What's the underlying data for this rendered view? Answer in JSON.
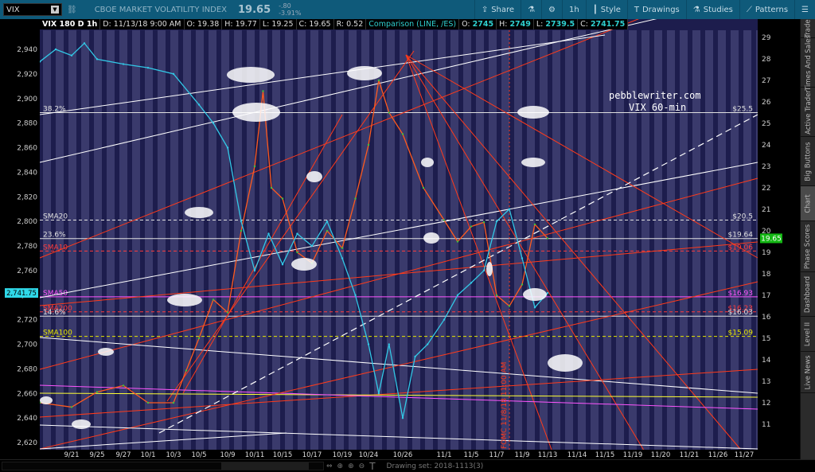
{
  "toolbar": {
    "symbol": "VIX",
    "name": "CBOE MARKET VOLATILITY INDEX",
    "price": "19.65",
    "change": "-.80",
    "change_pct": "-3.91%",
    "buttons": [
      {
        "label": "Share",
        "icon": "share-icon"
      },
      {
        "label": "",
        "icon": "flask-icon"
      },
      {
        "label": "",
        "icon": "gear-icon"
      },
      {
        "label": "1h",
        "icon": ""
      },
      {
        "label": "Style",
        "icon": "candle-icon"
      },
      {
        "label": "Drawings",
        "icon": "text-tool-icon"
      },
      {
        "label": "Studies",
        "icon": "flask-icon"
      },
      {
        "label": "Patterns",
        "icon": "pattern-icon"
      },
      {
        "label": "",
        "icon": "menu-icon"
      }
    ]
  },
  "infobar": {
    "title": "VIX 180 D 1h",
    "date": "D: 11/13/18 9:00 AM",
    "open": "O: 19.38",
    "high": "H: 19.77",
    "low": "L: 19.25",
    "close": "C: 19.65",
    "range": "R: 0.52",
    "comparison": "Comparison (LINE, /ES)",
    "cmp_open": "2745",
    "cmp_high": "2749",
    "cmp_low": "2739.5",
    "cmp_close": "2741.75"
  },
  "right_tabs": [
    "Trade",
    "Times And Sales",
    "Active Trader",
    "Big Buttons",
    "Chart",
    "Phase Scores",
    "Dashboard",
    "Level II",
    "Live News"
  ],
  "bottom": {
    "drawing_set": "Drawing set: 2018-1113(3)"
  },
  "annotations": {
    "site": "pebblewriter.com",
    "subtitle": "VIX 60-min",
    "fomc": "FOMC 11/8/18 11:00 AM"
  },
  "colors": {
    "bg": "#1d1d4d",
    "stripe": "#3a3a6c",
    "vix_up": "#3fbf3f",
    "vix_down": "#ff5a1e",
    "es": "#32c8e6",
    "accent": "#0f5a7a"
  },
  "chart_data": {
    "type": "line",
    "title": "VIX 180 D 1h with /ES comparison",
    "x_ticks": [
      "9/21",
      "9/25",
      "9/27",
      "10/1",
      "10/3",
      "10/5",
      "10/9",
      "10/11",
      "10/15",
      "10/17",
      "10/19",
      "10/24",
      "10/26",
      "11/1",
      "11/5",
      "11/7",
      "11/9",
      "11/13",
      "11/14",
      "11/15",
      "11/19",
      "11/20",
      "11/21",
      "11/26",
      "11/27"
    ],
    "left_axis": {
      "label": "/ES",
      "range": [
        2615,
        2955
      ],
      "ticks": [
        "2,940",
        "2,920",
        "2,900",
        "2,880",
        "2,860",
        "2,840",
        "2,820",
        "2,800",
        "2,780",
        "2,760",
        "2,740",
        "2,720",
        "2,700",
        "2,680",
        "2,660",
        "2,640",
        "2,620"
      ],
      "last": "2,741.75"
    },
    "right_axis": {
      "label": "VIX",
      "range": [
        10.5,
        29.5
      ],
      "ticks": [
        "29",
        "28",
        "27",
        "26",
        "25",
        "24",
        "23",
        "22",
        "21",
        "20",
        "19",
        "18",
        "17",
        "16",
        "15",
        "14",
        "13",
        "12",
        "11"
      ],
      "last": "19.65"
    },
    "series": [
      {
        "name": "VIX",
        "axis": "right",
        "x_index": [
          -1,
          0,
          1,
          2,
          3,
          4,
          4.5,
          5,
          5.5,
          6,
          6.5,
          7,
          7.3,
          7.6,
          8,
          8.5,
          9,
          9.5,
          10,
          10.5,
          11,
          11.3,
          11.6,
          12,
          12.5,
          13,
          13.5,
          14,
          14.5,
          15,
          15.5,
          16,
          16.5,
          17
        ],
        "values": [
          12,
          11.8,
          12.5,
          12.8,
          12,
          12,
          13.5,
          15,
          16.8,
          16.2,
          20,
          23,
          26.5,
          22,
          21.5,
          19,
          18.5,
          20,
          19.2,
          21.5,
          24,
          27,
          25.5,
          24.5,
          22,
          20.5,
          19.5,
          20.2,
          20.4,
          17,
          16.5,
          17.5,
          20.3,
          19.65
        ]
      },
      {
        "name": "/ES",
        "axis": "left",
        "x_index": [
          -1,
          -0.5,
          0,
          0.5,
          1,
          2,
          3,
          4,
          5,
          5.5,
          6,
          6.5,
          7,
          7.5,
          8,
          8.5,
          9,
          9.5,
          10,
          10.5,
          11,
          11.3,
          11.6,
          12,
          12.3,
          12.6,
          13,
          13.5,
          14,
          14.5,
          15,
          15.5,
          16,
          16.5,
          17
        ],
        "values": [
          2930,
          2940,
          2935,
          2945,
          2932,
          2928,
          2925,
          2920,
          2895,
          2880,
          2860,
          2800,
          2760,
          2790,
          2765,
          2790,
          2780,
          2800,
          2770,
          2740,
          2700,
          2660,
          2700,
          2640,
          2690,
          2700,
          2720,
          2740,
          2750,
          2760,
          2800,
          2810,
          2770,
          2730,
          2741.75
        ]
      }
    ],
    "levels": [
      {
        "label": "38.2%",
        "value_label": "$25.5",
        "value": 25.5,
        "color": "#e0e0e0"
      },
      {
        "label": "SMA20",
        "value_label": "$20.5",
        "value": 20.5,
        "color": "#e0e0e0"
      },
      {
        "label": "23.6%",
        "value_label": "$19.64",
        "value": 19.64,
        "color": "#e0e0e0"
      },
      {
        "label": "SMA10",
        "value_label": "$19.06",
        "value": 19.06,
        "color": "#ff3b3b"
      },
      {
        "label": "SMA50",
        "value_label": "$16.93",
        "value": 16.93,
        "color": "#ff55ff"
      },
      {
        "label": "SMA200",
        "value_label": "$16.23",
        "value": 16.23,
        "color": "#ff3b3b"
      },
      {
        "label": "14.6%",
        "value_label": "$16.03",
        "value": 16.03,
        "color": "#e0e0e0"
      },
      {
        "label": "SMA100",
        "value_label": "$15.09",
        "value": 15.09,
        "color": "#e6e600"
      }
    ],
    "grid": false,
    "legend": "none"
  }
}
